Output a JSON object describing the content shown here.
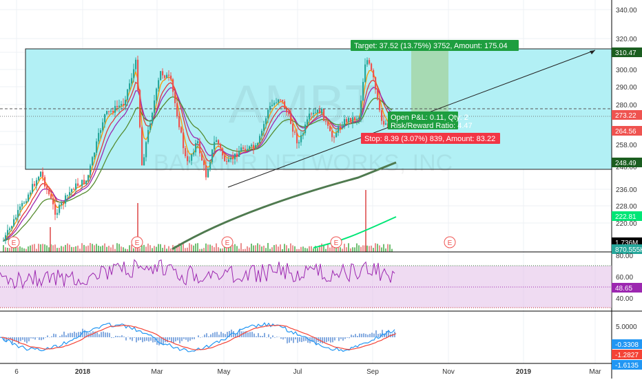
{
  "chart_data": {
    "type": "candlestick",
    "watermark": "AMBT",
    "watermark_subtitle": "BARRIER NETWORKS, INC",
    "price_axis": {
      "ticks": [
        "340.00",
        "320.00",
        "310.00",
        "300.00",
        "290.00",
        "280.00",
        "264.00",
        "258.00",
        "248.00",
        "236.00",
        "228.00",
        "220.00"
      ]
    },
    "price_badges": [
      {
        "label": "310.47",
        "color": "#1b5e20"
      },
      {
        "label": "273.22",
        "color": "#ef5350"
      },
      {
        "label": "264.56",
        "color": "#ef5350"
      },
      {
        "label": "248.49",
        "color": "#1b5e20"
      },
      {
        "label": "222.81",
        "color": "#00e676"
      },
      {
        "label": "1.736M",
        "color": "#000000"
      },
      {
        "label": "870.555K",
        "color": "#26a69a"
      }
    ],
    "time_axis": [
      "6",
      "2018",
      "Mar",
      "May",
      "Jul",
      "Sep",
      "Nov",
      "2019",
      "Mar"
    ],
    "position": {
      "target_label": "Target: 37.52 (13.75%) 3752, Amount: 175.04",
      "open_pnl_label": "Open P&L: 0.11, Qty: 2",
      "risk_reward_label": "Risk/Reward Ratio: 4.47",
      "stop_label": "Stop: 8.39 (3.07%) 839, Amount: 83.22"
    },
    "earnings_markers": [
      "E",
      "E",
      "E",
      "E",
      "E"
    ],
    "rsi": {
      "ticks": [
        "80.00",
        "60.00",
        "40.00"
      ],
      "value_label": "48.65",
      "color": "#9c27b0"
    },
    "macd": {
      "ticks": [
        "5.0000"
      ],
      "badges": [
        {
          "label": "-0.3308",
          "color": "#2196f3"
        },
        {
          "label": "-1.2827",
          "color": "#f44336"
        },
        {
          "label": "-1.6135",
          "color": "#2196f3"
        }
      ]
    },
    "colors": {
      "up": "#26a69a",
      "down": "#ef5350",
      "channel_fill": "#b2f0f5",
      "target_zone": "#a5d6a7",
      "stop_zone": "#ef9a9a"
    }
  }
}
